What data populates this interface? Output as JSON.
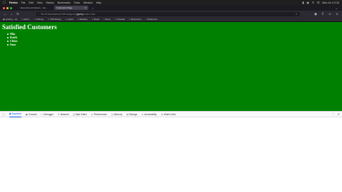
{
  "menubar": {
    "app_name": "Firefox",
    "items": [
      "File",
      "Edit",
      "View",
      "History",
      "Bookmarks",
      "Tools",
      "Window",
      "Help"
    ],
    "clock": "Mon Jul 4 2:15"
  },
  "tabs": [
    {
      "label": "Javascript and jQuery - Jav..."
    },
    {
      "label": "Customers Page"
    }
  ],
  "navbar": {
    "url_prefix": "file:///Users/kkemp/GitHub/jquery/",
    "url_highlight": "jquery",
    "url_suffix": "/index.html"
  },
  "bookmarks": [
    "Getting ...ed",
    "Admin",
    "Training",
    "TDD Debug",
    "Latest",
    "WebDev",
    "Email",
    "Docs",
    "Tutorials",
    "Resources",
    "Reference"
  ],
  "page": {
    "heading": "Satisfied Customers",
    "customers": [
      "Mia",
      "Keith",
      "Chloe",
      "Sam"
    ],
    "background": "#008000"
  },
  "devtools": {
    "tabs": [
      "Inspector",
      "Console",
      "Debugger",
      "Network",
      "Style Editor",
      "Performance",
      "Memory",
      "Storage",
      "Accessibility",
      "What's New"
    ],
    "active_tab": "Inspector"
  },
  "colors": {
    "page_bg": "#008000",
    "chrome_bg": "#1c1b22",
    "toolbar_bg": "#2b2a33",
    "devtools_accent": "#0060df"
  }
}
